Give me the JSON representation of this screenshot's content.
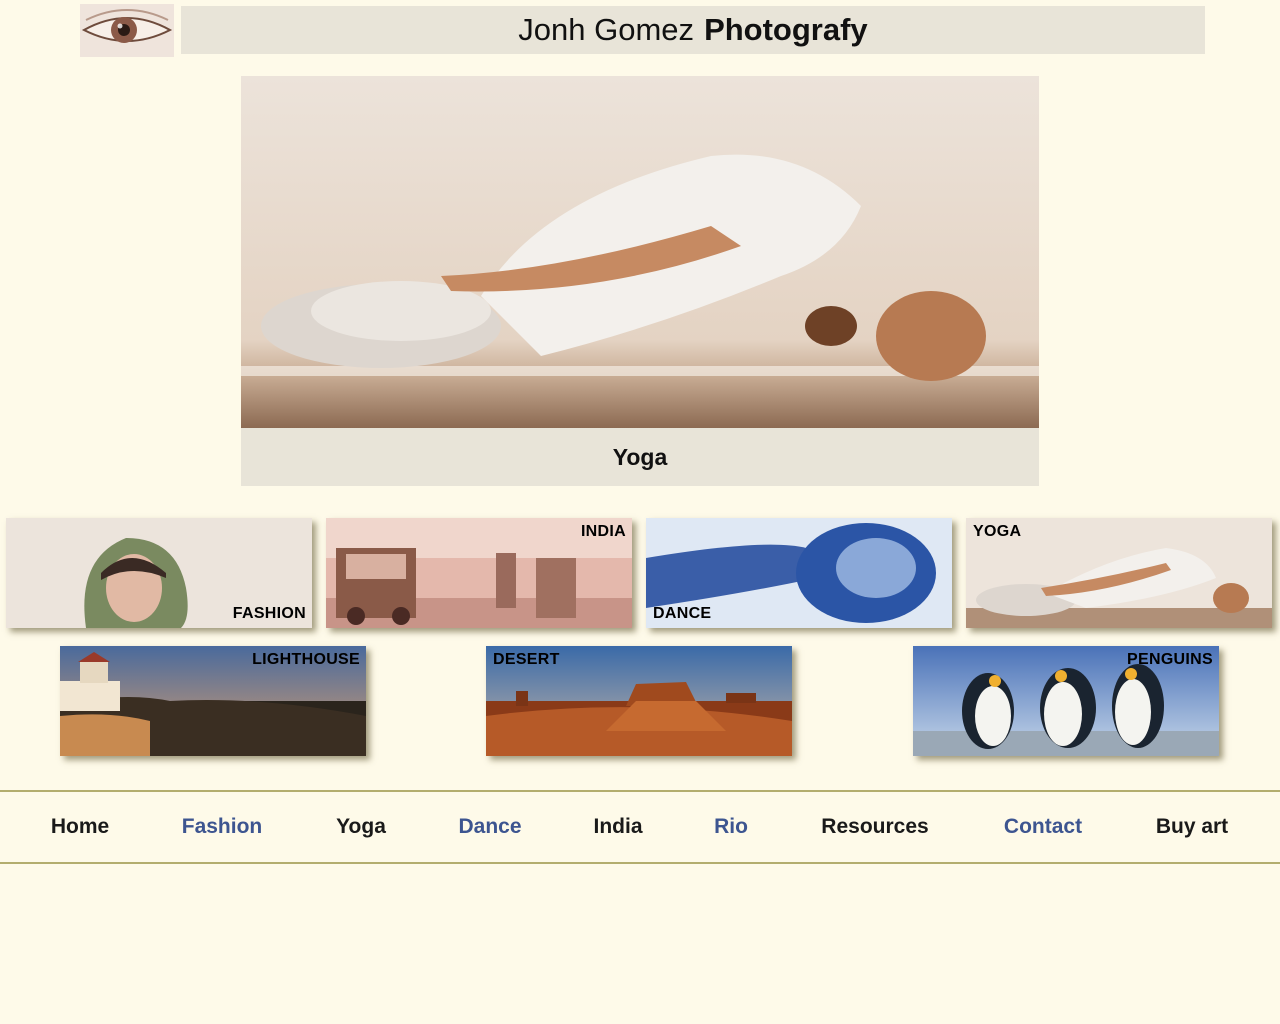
{
  "site": {
    "title_light": "Jonh Gomez",
    "title_bold": "Photografy"
  },
  "hero": {
    "caption": "Yoga"
  },
  "gallery": {
    "row1": [
      {
        "label": "FASHION"
      },
      {
        "label": "INDIA"
      },
      {
        "label": "DANCE"
      },
      {
        "label": "YOGA"
      }
    ],
    "row2": [
      {
        "label": "LIGHTHOUSE"
      },
      {
        "label": "DESERT"
      },
      {
        "label": "PENGUINS"
      }
    ]
  },
  "nav": {
    "items": [
      {
        "label": "Home",
        "color": "#1a1a1a"
      },
      {
        "label": "Fashion",
        "color": "#3d5590"
      },
      {
        "label": "Yoga",
        "color": "#1a1a1a"
      },
      {
        "label": "Dance",
        "color": "#3d5590"
      },
      {
        "label": "India",
        "color": "#1a1a1a"
      },
      {
        "label": "Rio",
        "color": "#3d5590"
      },
      {
        "label": "Resources",
        "color": "#1a1a1a"
      },
      {
        "label": "Contact",
        "color": "#3d5590"
      },
      {
        "label": "Buy art",
        "color": "#1a1a1a"
      }
    ]
  },
  "colors": {
    "background": "#fefae9",
    "panel": "#e8e4d8",
    "nav_border": "#b3ad6e",
    "link_blue": "#3d5590"
  }
}
